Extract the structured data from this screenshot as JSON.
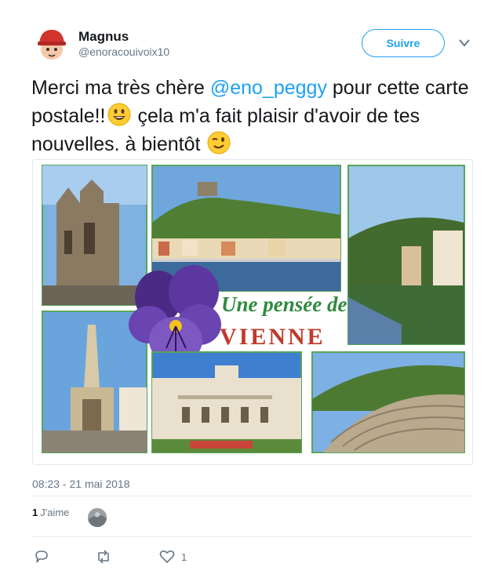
{
  "tweet": {
    "author_name": "Magnus",
    "author_handle": "@enoracouivoix10",
    "follow_label": "Suivre",
    "text_part1": "Merci ma très chère ",
    "mention": "@eno_peggy",
    "text_part2": " pour cette carte postale!!",
    "text_part3": " çela m'a fait plaisir d'avoir de tes nouvelles. à bientôt ",
    "postcard_caption_script": "Une pensée de",
    "postcard_caption_city": "VIENNE",
    "timestamp": "08:23 - 21 mai 2018",
    "likes_count": "1",
    "likes_label": "J'aime",
    "action_like_count": "1"
  },
  "icons": {
    "reply": "reply-icon",
    "retweet": "retweet-icon",
    "like": "heart-icon",
    "more": "chevron-down-icon"
  },
  "colors": {
    "accent": "#1da1f2",
    "secondary_text": "#657786",
    "postcard_title_green": "#2e8b3d",
    "postcard_city_red": "#c0392b"
  }
}
